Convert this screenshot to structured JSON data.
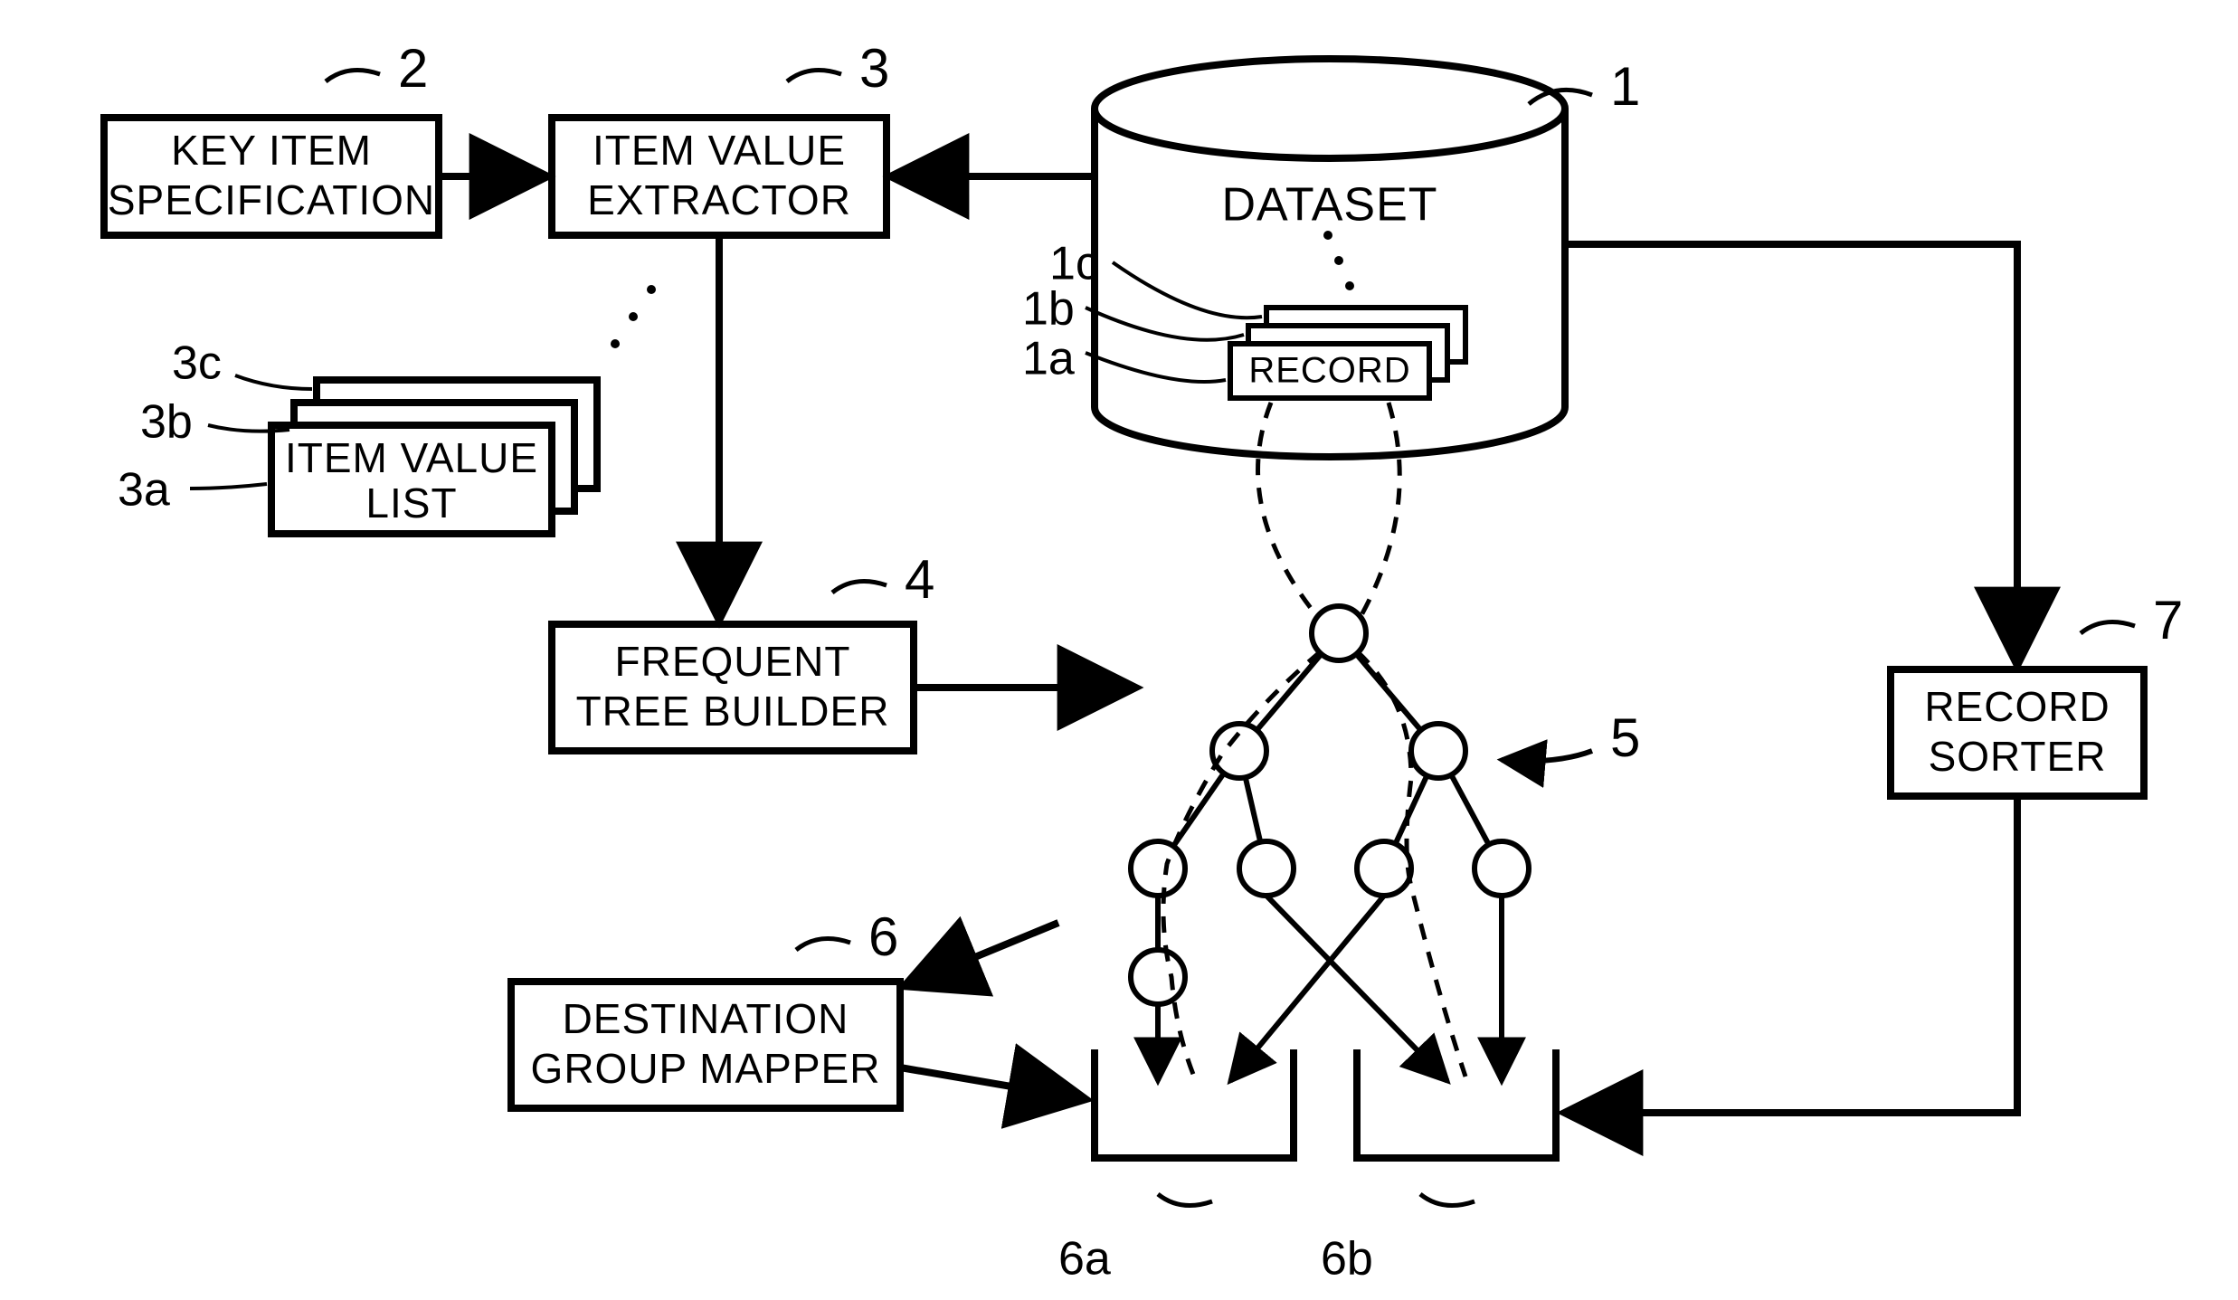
{
  "boxes": {
    "key_item_spec": {
      "num": "2",
      "line1": "KEY ITEM",
      "line2": "SPECIFICATION"
    },
    "item_value_extractor": {
      "num": "3",
      "line1": "ITEM VALUE",
      "line2": "EXTRACTOR"
    },
    "item_value_list": {
      "num_a": "3a",
      "num_b": "3b",
      "num_c": "3c",
      "line1": "ITEM VALUE",
      "line2": "LIST"
    },
    "frequent_tree_builder": {
      "num": "4",
      "line1": "FREQUENT",
      "line2": "TREE BUILDER"
    },
    "destination_group_mapper": {
      "num": "6",
      "line1": "DESTINATION",
      "line2": "GROUP MAPPER"
    },
    "record_sorter": {
      "num": "7",
      "line1": "RECORD",
      "line2": "SORTER"
    },
    "dataset": {
      "num": "1",
      "label": "DATASET",
      "record": "RECORD",
      "rec_a": "1a",
      "rec_b": "1b",
      "rec_c": "1c"
    }
  },
  "tree": {
    "num": "5"
  },
  "buckets": {
    "a": "6a",
    "b": "6b"
  }
}
